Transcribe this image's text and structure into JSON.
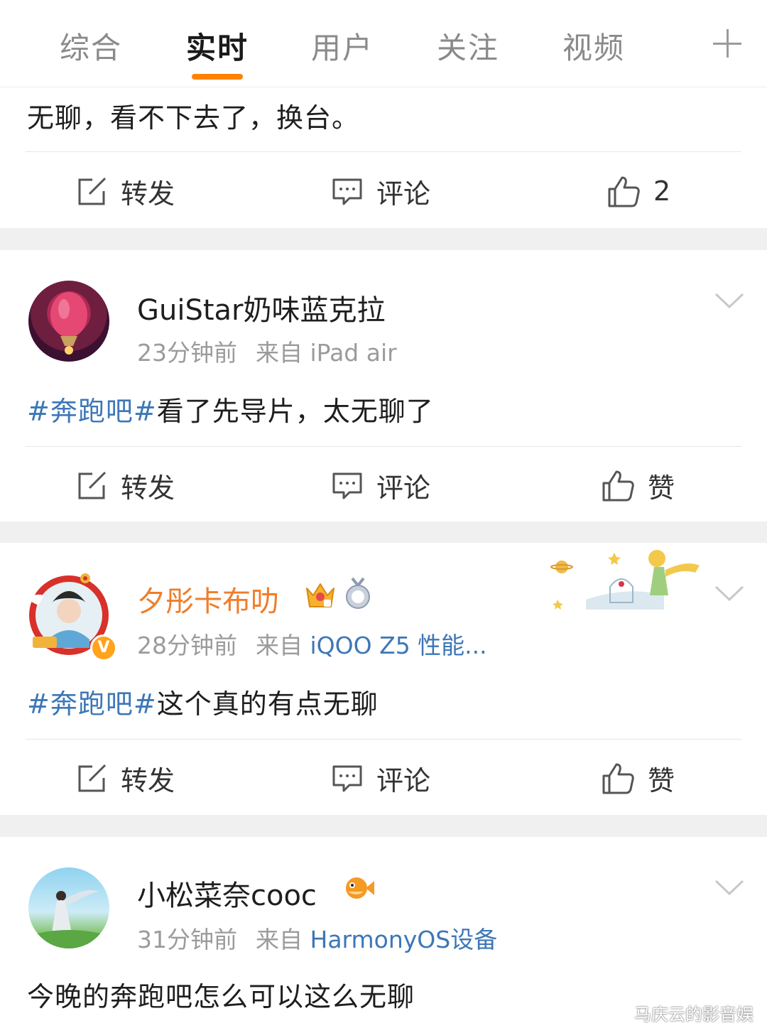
{
  "tabs": [
    {
      "label": "综合",
      "active": false
    },
    {
      "label": "实时",
      "active": true
    },
    {
      "label": "用户",
      "active": false
    },
    {
      "label": "关注",
      "active": false
    },
    {
      "label": "视频",
      "active": false
    }
  ],
  "colors": {
    "accent": "#ff8200",
    "topic_link": "#3d77b7",
    "vip_name": "#f07d29",
    "meta_gray": "#9b9b9b",
    "separator_bg": "#f0f0f0"
  },
  "icons": {
    "add_tab": "plus-icon",
    "repost": "share-icon",
    "comment": "comment-icon",
    "like": "thumbs-up-icon",
    "menu": "chevron-down-icon"
  },
  "posts": [
    {
      "text": "无聊，看不下去了，换台。",
      "actions": {
        "repost": "转发",
        "comment": "评论",
        "like": "2"
      }
    },
    {
      "username": "GuiStar奶味蓝克拉",
      "time": "23分钟前",
      "source_prefix": "来自",
      "source": "iPad air",
      "topic": "#奔跑吧#",
      "text": "看了先导片，太无聊了",
      "actions": {
        "repost": "转发",
        "comment": "评论",
        "like": "赞"
      }
    },
    {
      "username": "夕彤卡布叻",
      "badges": [
        "crown-icon",
        "medal-icon"
      ],
      "verified_badge": "V",
      "time": "28分钟前",
      "source_prefix": "来自",
      "source": "iQOO Z5 性能...",
      "topic": "#奔跑吧#",
      "text": "这个真的有点无聊",
      "actions": {
        "repost": "转发",
        "comment": "评论",
        "like": "赞"
      }
    },
    {
      "username": "小松菜奈cooc",
      "badges": [
        "pufferfish-icon"
      ],
      "time": "31分钟前",
      "source_prefix": "来自",
      "source": "HarmonyOS设备",
      "text": "今晚的奔跑吧怎么可以这么无聊"
    }
  ],
  "watermark": "马庆云的影音娱"
}
